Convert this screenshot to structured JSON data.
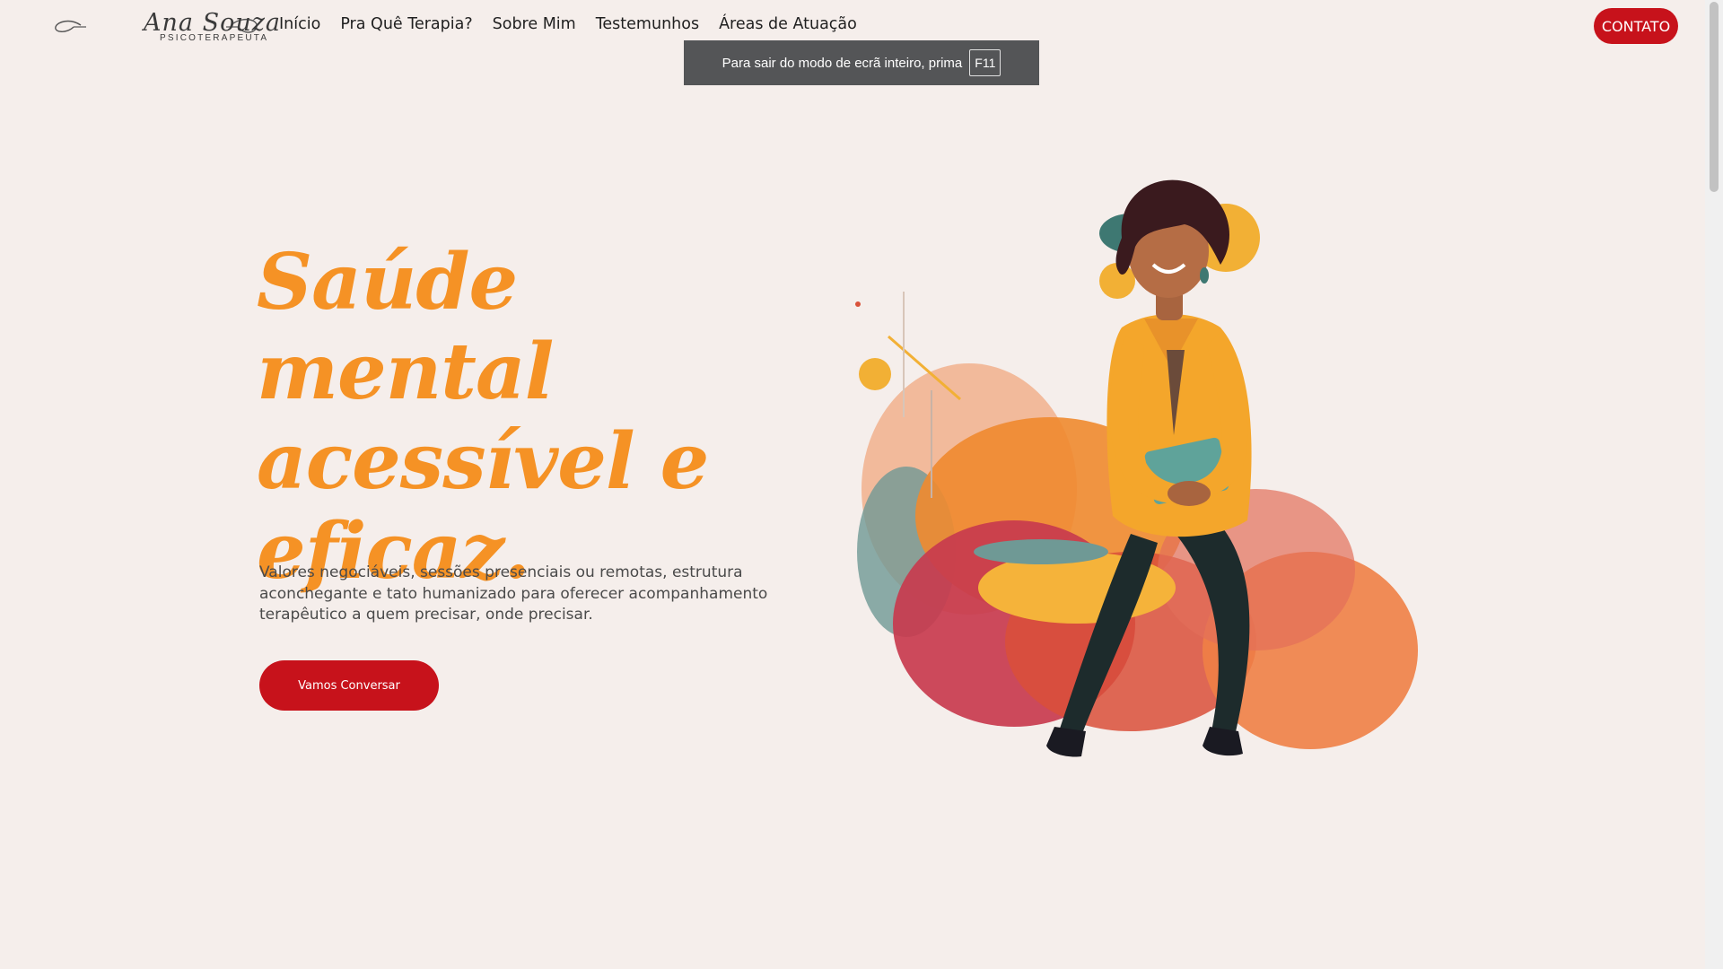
{
  "brand": {
    "name": "Ana Souza",
    "subtitle": "PSICOTERAPEUTA"
  },
  "nav": {
    "items": [
      "Início",
      "Pra Quê Terapia?",
      "Sobre Mim",
      "Testemunhos",
      "Áreas de Atuação"
    ]
  },
  "header": {
    "contact_label": "CONTATO"
  },
  "toast": {
    "message": "Para sair do modo de ecrã inteiro, prima",
    "key": "F11"
  },
  "hero": {
    "headline": "Saúde mental acessível e eficaz.",
    "description": "Valores negociáveis, sessões presenciais ou remotas, estrutura aconchegante e tato humanizado para oferecer acompanhamento terapêutico a quem precisar, onde precisar.",
    "cta_label": "Vamos Conversar"
  },
  "colors": {
    "background": "#f5eeeb",
    "accent_red": "#c7121b",
    "headline_orange": "#f59225",
    "toast_bg": "#545557"
  }
}
